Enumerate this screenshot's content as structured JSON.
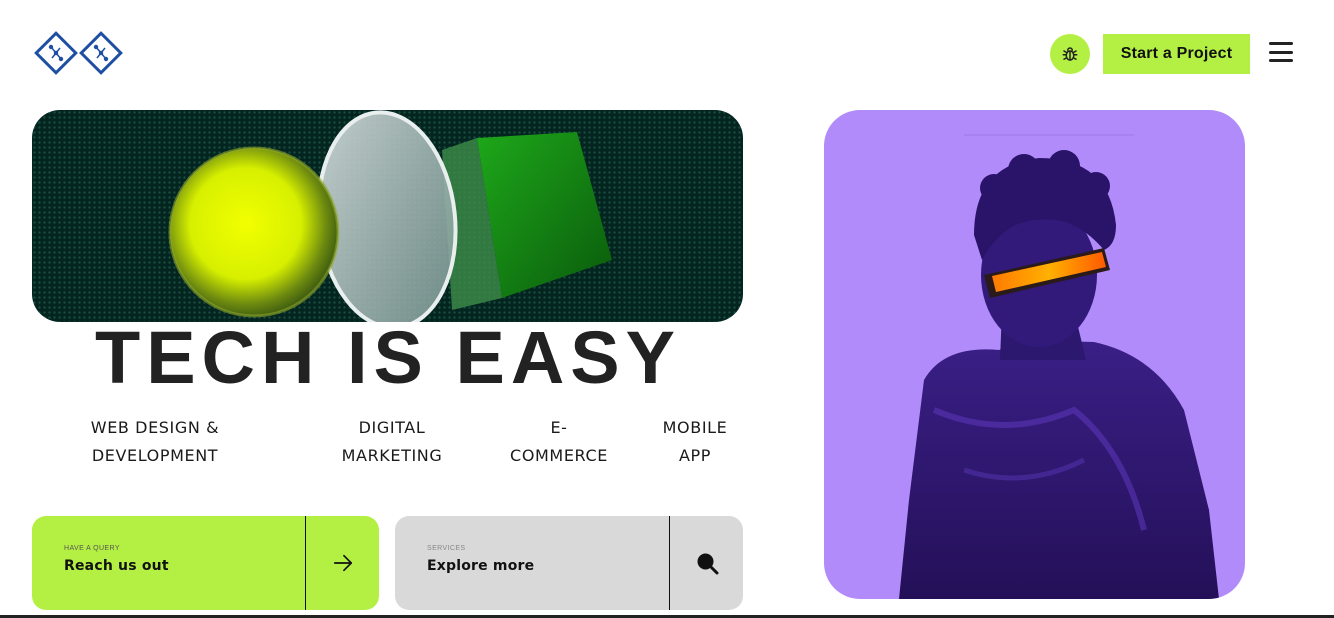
{
  "header": {
    "logo_icon": "diamond-logo-icon",
    "bug_icon": "bug-icon",
    "cta_label": "Start a Project",
    "menu_icon": "hamburger-menu-icon"
  },
  "hero": {
    "headline": "TECH IS EASY"
  },
  "services": [
    {
      "line1": "WEB DESIGN &",
      "line2": "DEVELOPMENT"
    },
    {
      "line1": "DIGITAL",
      "line2": "MARKETING"
    },
    {
      "line1": "E-",
      "line2": "COMMERCE"
    },
    {
      "line1": "MOBILE",
      "line2": "APP"
    }
  ],
  "cards": {
    "query": {
      "small": "HAVE A QUERY",
      "big": "Reach us out",
      "icon": "arrow-right-icon"
    },
    "services": {
      "small": "SERVICES",
      "big": "Explore more",
      "icon": "search-icon"
    }
  },
  "colors": {
    "accent": "#b4f043",
    "purple": "#b28bfa",
    "banner_bg": "#03241f",
    "logo_blue": "#1f4fa3"
  }
}
